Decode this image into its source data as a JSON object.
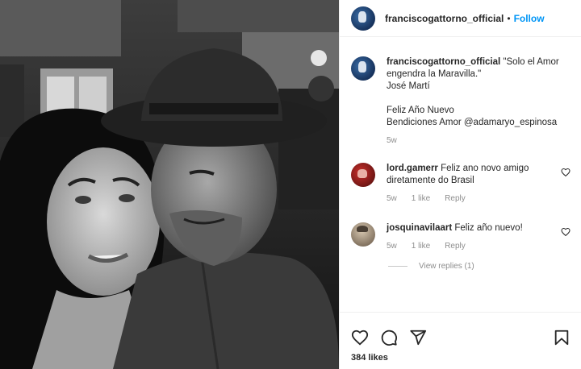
{
  "post": {
    "author": "franciscogattorno_official",
    "separator": "•",
    "follow_label": "Follow",
    "likes_label": "384 likes"
  },
  "caption": {
    "username": "franciscogattorno_official",
    "line1": "\"Solo el Amor engendra la Maravilla.\"",
    "line2": "José Martí",
    "line3": "Feliz Año Nuevo",
    "line4": "Bendiciones Amor @adamaryo_espinosa",
    "time": "5w"
  },
  "comments": [
    {
      "username": "lord.gamerr",
      "text": "Feliz ano novo amigo diretamente do Brasil",
      "time": "5w",
      "likes": "1 like",
      "reply": "Reply"
    },
    {
      "username": "josquinavilaart",
      "text": "Feliz año nuevo!",
      "time": "5w",
      "likes": "1 like",
      "reply": "Reply"
    }
  ],
  "view_replies_label": "View replies (1)",
  "colors": {
    "follow": "#0095f6",
    "meta": "#8e8e8e",
    "text": "#262626"
  },
  "icons": [
    "heart-icon",
    "comment-icon",
    "share-icon",
    "bookmark-icon",
    "heart-small-icon"
  ]
}
